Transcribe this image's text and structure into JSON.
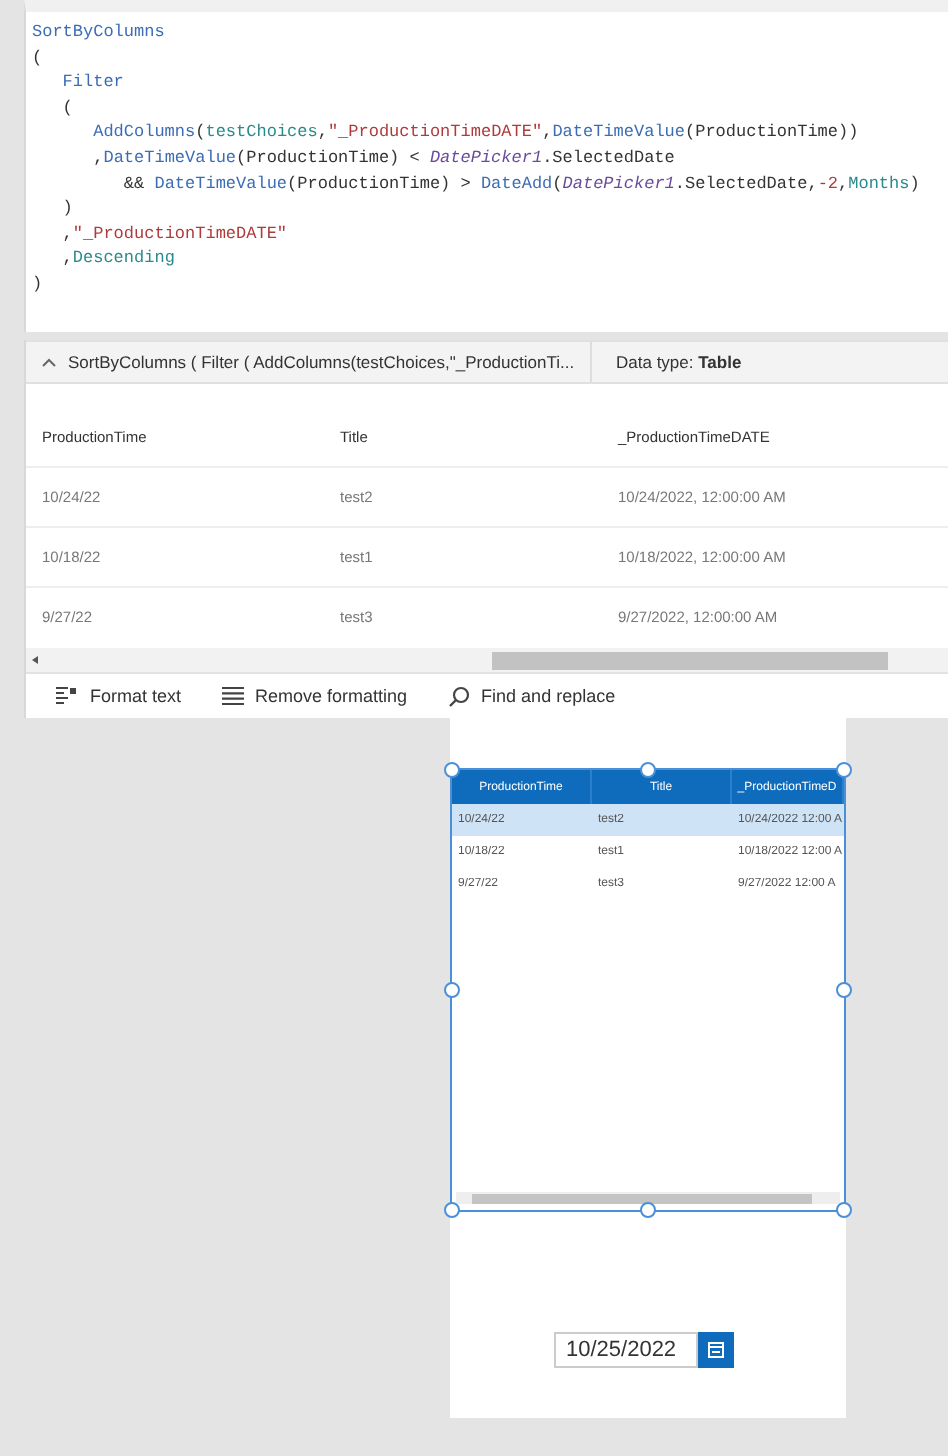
{
  "formula": {
    "lines": [
      {
        "tokens": [
          {
            "kind": "func",
            "text": "SortByColumns"
          }
        ]
      },
      {
        "tokens": [
          {
            "kind": "plain",
            "text": "("
          }
        ]
      },
      {
        "tokens": [
          {
            "kind": "func",
            "text": "   Filter"
          }
        ]
      },
      {
        "tokens": [
          {
            "kind": "plain",
            "text": "   ("
          }
        ]
      },
      {
        "tokens": [
          {
            "kind": "func",
            "text": "      AddColumns"
          },
          {
            "kind": "plain",
            "text": "("
          },
          {
            "kind": "ident",
            "text": "testChoices"
          },
          {
            "kind": "plain",
            "text": ","
          },
          {
            "kind": "string",
            "text": "\"_ProductionTimeDATE\""
          },
          {
            "kind": "plain",
            "text": ","
          },
          {
            "kind": "func",
            "text": "DateTimeValue"
          },
          {
            "kind": "plain",
            "text": "(ProductionTime))"
          }
        ]
      },
      {
        "tokens": [
          {
            "kind": "plain",
            "text": "      ,"
          },
          {
            "kind": "func",
            "text": "DateTimeValue"
          },
          {
            "kind": "plain",
            "text": "(ProductionTime) < "
          },
          {
            "kind": "control",
            "text": "DatePicker1"
          },
          {
            "kind": "plain",
            "text": ".SelectedDate"
          }
        ]
      },
      {
        "tokens": [
          {
            "kind": "plain",
            "text": "         && "
          },
          {
            "kind": "func",
            "text": "DateTimeValue"
          },
          {
            "kind": "plain",
            "text": "(ProductionTime) > "
          },
          {
            "kind": "func",
            "text": "DateAdd"
          },
          {
            "kind": "plain",
            "text": "("
          },
          {
            "kind": "control",
            "text": "DatePicker1"
          },
          {
            "kind": "plain",
            "text": ".SelectedDate,"
          },
          {
            "kind": "string",
            "text": "-2"
          },
          {
            "kind": "plain",
            "text": ","
          },
          {
            "kind": "ident",
            "text": "Months"
          },
          {
            "kind": "plain",
            "text": ")"
          }
        ]
      },
      {
        "tokens": [
          {
            "kind": "plain",
            "text": "   )"
          }
        ]
      },
      {
        "tokens": [
          {
            "kind": "plain",
            "text": "   ,"
          },
          {
            "kind": "string",
            "text": "\"_ProductionTimeDATE\""
          }
        ]
      },
      {
        "tokens": [
          {
            "kind": "plain",
            "text": "   ,"
          },
          {
            "kind": "ident",
            "text": "Descending"
          }
        ]
      },
      {
        "tokens": [
          {
            "kind": "plain",
            "text": ")"
          }
        ]
      }
    ]
  },
  "result_bar": {
    "expanded": true,
    "summary": "SortByColumns ( Filter ( AddColumns(testChoices,\"_ProductionTi...",
    "data_type": "Data type: **Table**"
  },
  "result_table": {
    "columns": [
      "ProductionTime",
      "Title",
      "_ProductionTimeDATE"
    ],
    "rows": [
      [
        "10/24/22",
        "test2",
        "10/24/2022, 12:00:00 AM"
      ],
      [
        "10/18/22",
        "test1",
        "10/18/2022, 12:00:00 AM"
      ],
      [
        "9/27/22",
        "test3",
        "9/27/2022, 12:00:00 AM"
      ]
    ]
  },
  "toolbar": {
    "buttons": [
      {
        "kind": "format",
        "label": "Format text"
      },
      {
        "kind": "remove",
        "label": "Remove formatting"
      },
      {
        "kind": "find",
        "label": "Find and replace"
      }
    ]
  },
  "gallery": {
    "columns": [
      "ProductionTime",
      "Title",
      "_ProductionTimeD"
    ],
    "rows": [
      {
        "cells": [
          "10/24/22",
          "test2",
          "10/24/2022 12:00 A"
        ],
        "selected": true
      },
      {
        "cells": [
          "10/18/22",
          "test1",
          "10/18/2022 12:00 A"
        ],
        "selected": false
      },
      {
        "cells": [
          "9/27/22",
          "test3",
          "9/27/2022 12:00 A"
        ],
        "selected": false
      }
    ]
  },
  "date_picker": {
    "value": "10/25/2022"
  }
}
